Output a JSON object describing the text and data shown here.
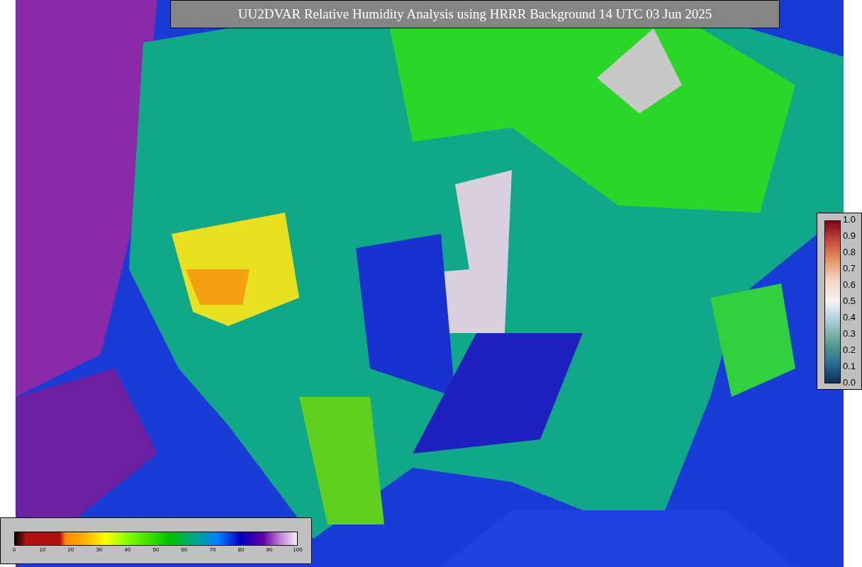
{
  "title": "UU2DVAR Relative Humidity Analysis using HRRR Background 14 UTC 03 Jun 2025",
  "right_colorbar": {
    "ticks": [
      "1.0",
      "0.9",
      "0.8",
      "0.7",
      "0.6",
      "0.5",
      "0.4",
      "0.3",
      "0.2",
      "0.1",
      "0.0"
    ]
  },
  "bottom_colorbar": {
    "ticks": [
      "0",
      "10",
      "20",
      "30",
      "40",
      "50",
      "60",
      "70",
      "80",
      "90",
      "100"
    ]
  }
}
